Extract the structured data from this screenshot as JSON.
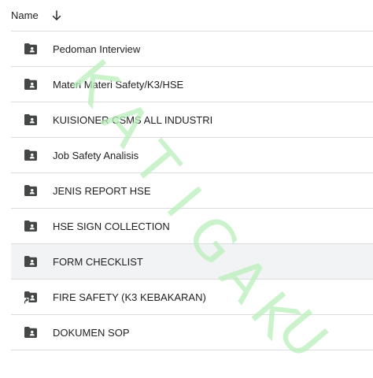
{
  "header": {
    "name_label": "Name",
    "sort_icon": "arrow-down-icon"
  },
  "items": [
    {
      "label": "Pedoman Interview",
      "icon": "shared-folder-icon"
    },
    {
      "label": "Materi Materi Safety/K3/HSE",
      "icon": "shared-folder-icon"
    },
    {
      "label": "KUISIONER CSMS ALL INDUSTRI",
      "icon": "shared-folder-icon"
    },
    {
      "label": "Job Safety Analisis",
      "icon": "shared-folder-icon"
    },
    {
      "label": "JENIS REPORT HSE",
      "icon": "shared-folder-icon"
    },
    {
      "label": "HSE SIGN COLLECTION",
      "icon": "shared-folder-icon"
    },
    {
      "label": "FORM CHECKLIST",
      "icon": "shared-folder-icon"
    },
    {
      "label": "FIRE SAFETY (K3 KEBAKARAN)",
      "icon": "shared-folder-shortcut-icon"
    },
    {
      "label": "DOKUMEN SOP",
      "icon": "shared-folder-icon"
    }
  ],
  "selected_index": 6,
  "watermark": {
    "letters": [
      "K",
      "A",
      "T",
      "I",
      "G",
      "A",
      "K",
      "U"
    ],
    "color": "#b9efb9"
  },
  "colors": {
    "divider": "#dadce0",
    "selected_row": "#f1f3f4",
    "icon": "#444746"
  }
}
